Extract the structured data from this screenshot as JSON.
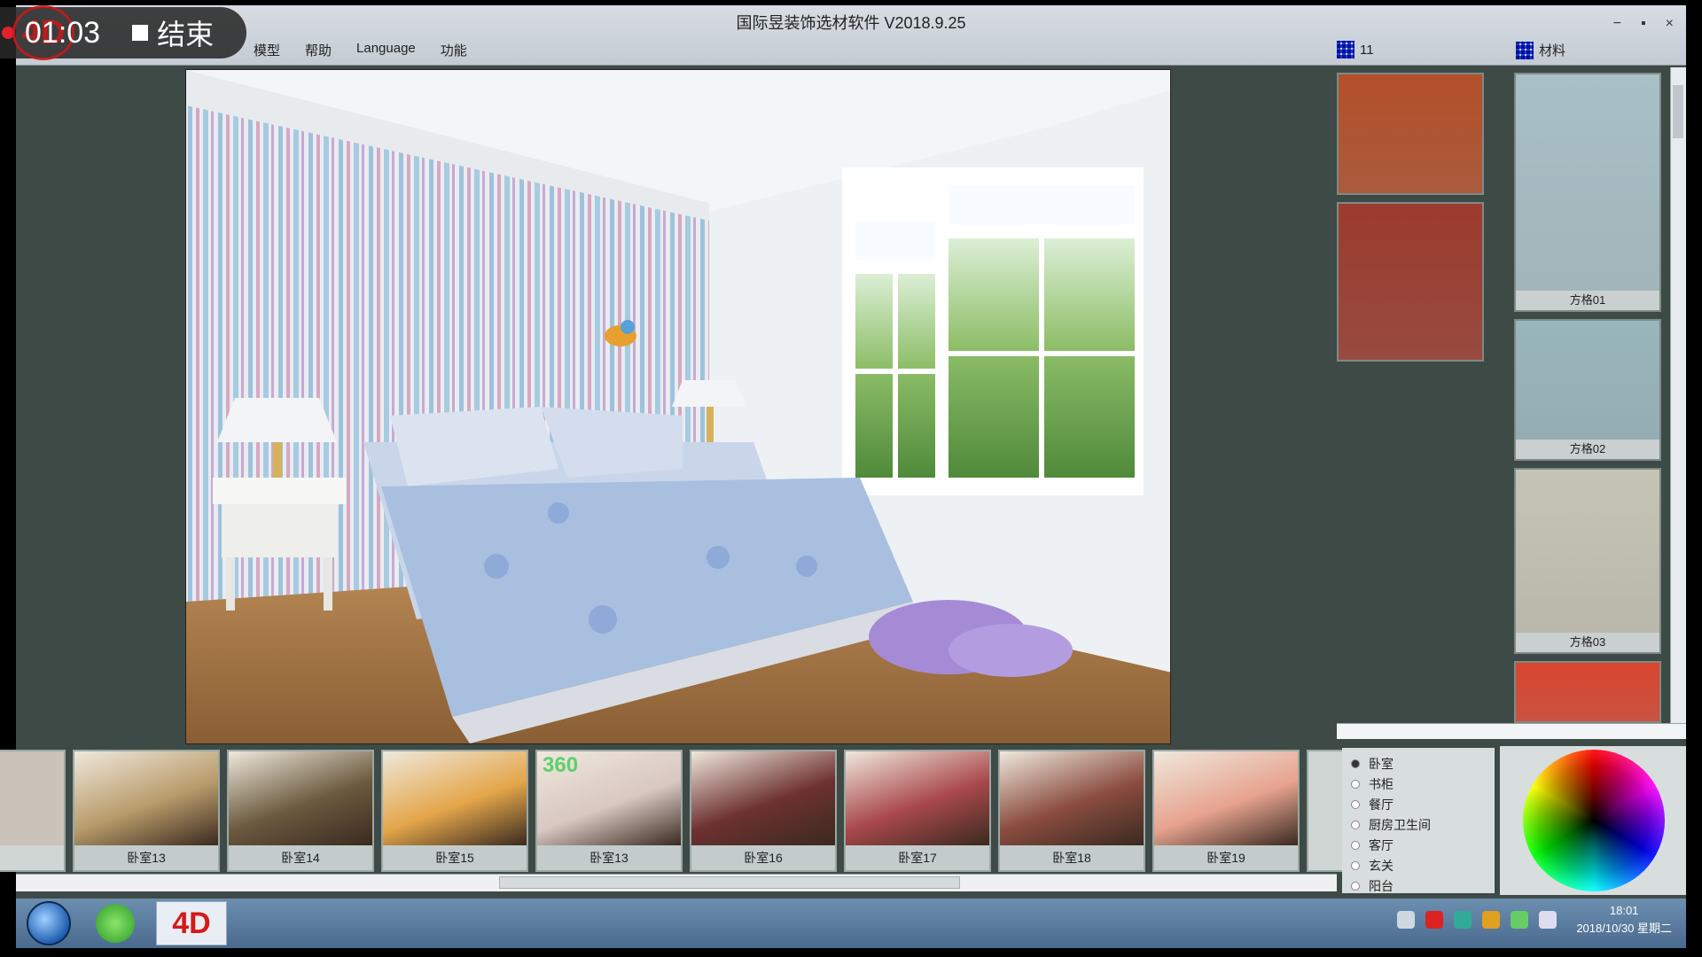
{
  "recording": {
    "time": "01:03",
    "stop_label": "结束"
  },
  "app": {
    "title": "国际昱装饰选材软件 V2018.9.25",
    "menu": [
      "模型",
      "帮助",
      "Language",
      "功能"
    ],
    "panel_tabs": [
      {
        "label": "11",
        "icon": "grid-icon"
      },
      {
        "label": "材料",
        "icon": "grid-icon"
      }
    ],
    "window_controls": [
      "−",
      "▪",
      "×"
    ]
  },
  "swatches_left": [
    {
      "label": "",
      "color": "#b3502a"
    },
    {
      "label": "",
      "color": "#9c3b2e"
    }
  ],
  "swatches_right": [
    {
      "label": "方格01",
      "color": "#a8c0c6"
    },
    {
      "label": "方格02",
      "color": "#98b6bc"
    },
    {
      "label": "方格03",
      "color": "#c5c4b4"
    },
    {
      "label": "",
      "color": "#d9452f"
    }
  ],
  "thumbnails": [
    {
      "label": "卧室13",
      "tone": "#b89b6a"
    },
    {
      "label": "卧室14",
      "tone": "#6b5a3e"
    },
    {
      "label": "卧室15",
      "tone": "#e4a64a"
    },
    {
      "label": "卧室13",
      "tone": "#d9c7c2",
      "badge": "360"
    },
    {
      "label": "卧室16",
      "tone": "#6d3130"
    },
    {
      "label": "卧室17",
      "tone": "#a9484b"
    },
    {
      "label": "卧室18",
      "tone": "#8a4c3f"
    },
    {
      "label": "卧室19",
      "tone": "#e7a38f"
    }
  ],
  "room_list": {
    "items": [
      "卧室",
      "书柜",
      "餐厅",
      "厨房卫生间",
      "客厅",
      "玄关",
      "阳台"
    ],
    "selected": 0
  },
  "taskbar": {
    "app_label": "4D",
    "clock_time": "18:01",
    "clock_date": "2018/10/30 星期二"
  }
}
